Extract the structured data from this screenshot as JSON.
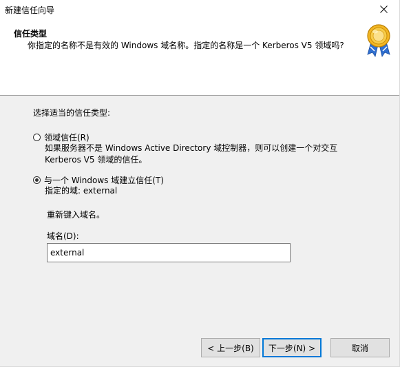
{
  "window": {
    "title": "新建信任向导"
  },
  "header": {
    "title": "信任类型",
    "subtitle": "你指定的名称不是有效的 Windows 域名称。指定的名称是一个 Kerberos V5 领域吗?",
    "icon": "certificate-badge-icon"
  },
  "main": {
    "prompt": "选择适当的信任类型:",
    "options": [
      {
        "label": "领域信任(R)",
        "checked": false,
        "description_line1": "如果服务器不是 Windows Active Directory 域控制器，则可以创建一个对交互",
        "description_line2": "Kerberos V5 领域的信任。"
      },
      {
        "label": "与一个 Windows 域建立信任(T)",
        "checked": true,
        "description_line1": "指定的域: external"
      }
    ],
    "retype_prompt": "重新键入域名。",
    "domain_label": "域名(D):",
    "domain_value": "external"
  },
  "footer": {
    "back_label": "< 上一步(B)",
    "next_label": "下一步(N) >",
    "cancel_label": "取消"
  }
}
